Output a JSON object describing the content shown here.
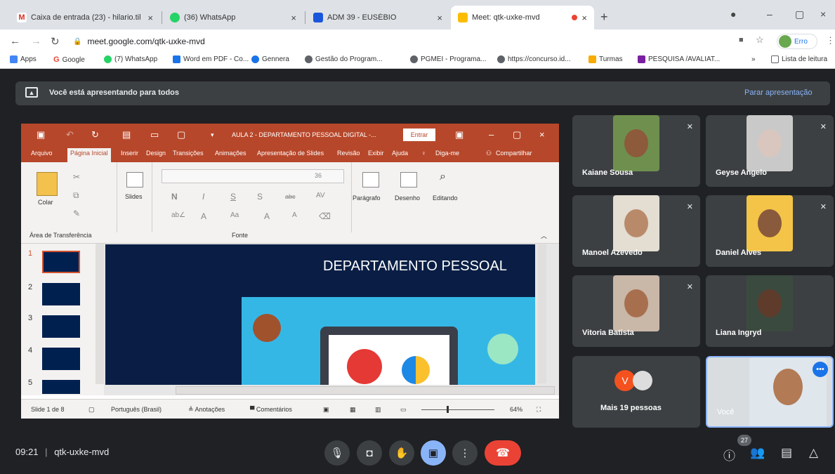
{
  "browser": {
    "tabs": [
      {
        "title": "Caixa de entrada (23) - hilario.til",
        "color": "#d93025"
      },
      {
        "title": "(36) WhatsApp",
        "color": "#25d366"
      },
      {
        "title": "ADM 39 - EUSÉBIO",
        "color": "#1a56db"
      },
      {
        "title": "Meet: qtk-uxke-mvd",
        "color": "#fbbc04"
      }
    ],
    "url": "meet.google.com/qtk-uxke-mvd",
    "profile_label": "Erro",
    "bookmarks": [
      {
        "label": "Apps",
        "color": "#4285f4"
      },
      {
        "label": "Google",
        "color": "#ea4335"
      },
      {
        "label": "(7) WhatsApp",
        "color": "#25d366"
      },
      {
        "label": "Word em PDF - Co...",
        "color": "#1a73e8"
      },
      {
        "label": "Gennera",
        "color": "#1a73e8"
      },
      {
        "label": "Gestão do Program...",
        "color": "#5f6368"
      },
      {
        "label": "PGMEI - Programa...",
        "color": "#5f6368"
      },
      {
        "label": "https://concurso.id...",
        "color": "#5f6368"
      },
      {
        "label": "Turmas",
        "color": "#f9ab00"
      },
      {
        "label": "PESQUISA /AVALIAT...",
        "color": "#7b1fa2"
      }
    ],
    "reading_list": "Lista de leitura",
    "bookmarks_more": "»"
  },
  "presenting": {
    "text": "Você está apresentando para todos",
    "stop": "Parar apresentação"
  },
  "ppt": {
    "doc_title": "AULA 2 - DEPARTAMENTO PESSOAL DIGITAL -...",
    "entrar": "Entrar",
    "menu": [
      "Arquivo",
      "Página Inicial",
      "Inserir",
      "Design",
      "Transições",
      "Animações",
      "Apresentação de Slides",
      "Revisão",
      "Exibir",
      "Ajuda",
      "Diga-me",
      "Compartilhar"
    ],
    "ribbon": {
      "colar": "Colar",
      "slides": "Slides",
      "font_size": "36",
      "paragrafo": "Parágrafo",
      "desenho": "Desenho",
      "editando": "Editando",
      "area_transf": "Área de Transferência",
      "fonte": "Fonte",
      "font_glyphs": [
        "N",
        "I",
        "S",
        "S",
        "abc",
        "AV",
        "A",
        "Aa",
        "A",
        "A"
      ]
    },
    "thumb_numbers": [
      "1",
      "2",
      "3",
      "4",
      "5"
    ],
    "slide_title": "DEPARTAMENTO PESSOAL",
    "status": {
      "slide": "Slide 1 de 8",
      "lang": "Português (Brasil)",
      "notes": "Anotações",
      "comments": "Comentários",
      "zoom": "64%"
    }
  },
  "participants": [
    {
      "name": "Kaiane Sousa",
      "skin": "#8d5a3b",
      "bg": "#6f8f4e"
    },
    {
      "name": "Geyse Angelo",
      "skin": "#d9c7bf",
      "bg": "#c9c9c9"
    },
    {
      "name": "Manoel Azevedo",
      "skin": "#b98a6a",
      "bg": "#e3ddd2"
    },
    {
      "name": "Daniel Alves",
      "skin": "#8a5a3c",
      "bg": "#f3c447"
    },
    {
      "name": "Vitoria Batista",
      "skin": "#a86f4f",
      "bg": "#c9b7a8"
    },
    {
      "name": "Liana Ingryd",
      "skin": "#5e3b2a",
      "bg": "#3b4a3f"
    }
  ],
  "more_people": {
    "avatar_letter": "V",
    "label": "Mais 19 pessoas"
  },
  "self": {
    "name": "Você",
    "skin": "#b27a55"
  },
  "meeting": {
    "time": "09:21",
    "separator": "|",
    "code": "qtk-uxke-mvd",
    "participant_count": "27"
  }
}
